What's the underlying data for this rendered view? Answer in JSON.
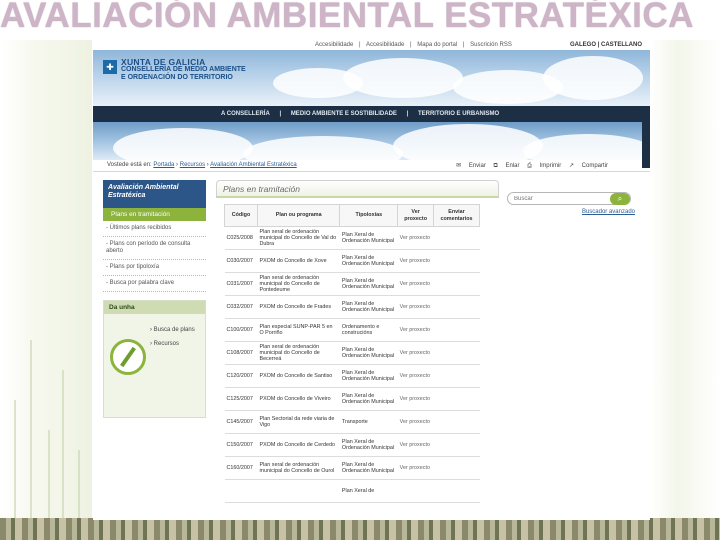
{
  "slide_title": "AVALIACIÓN AMBIENTAL ESTRATÉXICA",
  "utility": {
    "links": [
      "Accesibilidade",
      "|",
      "Accesibilidade",
      "|",
      "Mapa do portal",
      "|",
      "Suscrición RSS"
    ],
    "lang": "GALEGO | CASTELLANO"
  },
  "brand": {
    "line1": "XUNTA DE GALICIA",
    "line2": "CONSELLERÍA DE MEDIO AMBIENTE",
    "line3": "E ORDENACIÓN DO TERRITORIO"
  },
  "nav": {
    "items": [
      "A CONSELLERÍA",
      "|",
      "MEDIO AMBIENTE E SOSTIBILIDADE",
      "|",
      "TERRITORIO E URBANISMO"
    ]
  },
  "breadcrumb": {
    "prefix": "Vostede está en:",
    "items": [
      "Portada",
      "Recursos",
      "Avaliación Ambiental Estratéxica"
    ]
  },
  "page_tools": [
    "Enviar",
    "Enlar",
    "Imprimir",
    "Compartir"
  ],
  "sidebar": {
    "heading": "Avaliación Ambiental Estratéxica",
    "active": "Plans en tramitación",
    "items": [
      "- Últimos plans recibidos",
      "- Plans con período de consulta aberto",
      "- Plans por tipoloxía",
      "- Busca por palabra clave"
    ]
  },
  "visit": {
    "heading": "Da unha",
    "links": [
      "Busca de plans",
      "Recursos"
    ]
  },
  "content": {
    "title": "Plans en tramitación",
    "columns": [
      "Código",
      "Plan ou programa",
      "Tipoloxías",
      "Ver proxecto",
      "Enviar comentarios"
    ],
    "rows": [
      {
        "code": "C025/2008",
        "plan": "Plan xeral de ordenación municipal do Concello de Val do Dubra",
        "tip": "Plan Xeral de Ordenación Municipal",
        "ver": "Ver proxecto"
      },
      {
        "code": "C030/2007",
        "plan": "PXOM do Concello de Xove",
        "tip": "Plan Xeral de Ordenación Municipal",
        "ver": "Ver proxecto"
      },
      {
        "code": "C031/2007",
        "plan": "Plan xeral de ordenación municipal do Concello de Pontedeume",
        "tip": "Plan Xeral de Ordenación Municipal",
        "ver": "Ver proxecto"
      },
      {
        "code": "C032/2007",
        "plan": "PXOM do Concello de Frades",
        "tip": "Plan Xeral de Ordenación Municipal",
        "ver": "Ver proxecto"
      },
      {
        "code": "C100/2007",
        "plan": "Plan especial SUNP-PAR 5 en O Porriño",
        "tip": "Ordenamento e construcións",
        "ver": "Ver proxecto"
      },
      {
        "code": "C108/2007",
        "plan": "Plan xeral de ordenación municipal do Concello de Becerreá",
        "tip": "Plan Xeral de Ordenación Municipal",
        "ver": "Ver proxecto"
      },
      {
        "code": "C120/2007",
        "plan": "PXOM do Concello de Santiso",
        "tip": "Plan Xeral de Ordenación Municipal",
        "ver": "Ver proxecto"
      },
      {
        "code": "C125/2007",
        "plan": "PXOM do Concello de Viveiro",
        "tip": "Plan Xeral de Ordenación Municipal",
        "ver": "Ver proxecto"
      },
      {
        "code": "C145/2007",
        "plan": "Plan Sectorial da rede viaria de Vigo",
        "tip": "Transporte",
        "ver": "Ver proxecto"
      },
      {
        "code": "C150/2007",
        "plan": "PXOM do Concello de Cerdedo",
        "tip": "Plan Xeral de Ordenación Municipal",
        "ver": "Ver proxecto"
      },
      {
        "code": "C160/2007",
        "plan": "Plan xeral de ordenación municipal do Concello de Ourol",
        "tip": "Plan Xeral de Ordenación Municipal",
        "ver": "Ver proxecto"
      },
      {
        "code": "",
        "plan": "",
        "tip": "Plan Xeral de",
        "ver": ""
      }
    ]
  },
  "search": {
    "placeholder": "Buscar",
    "button_icon": "search-icon",
    "advanced": "Buscador avanzado"
  }
}
